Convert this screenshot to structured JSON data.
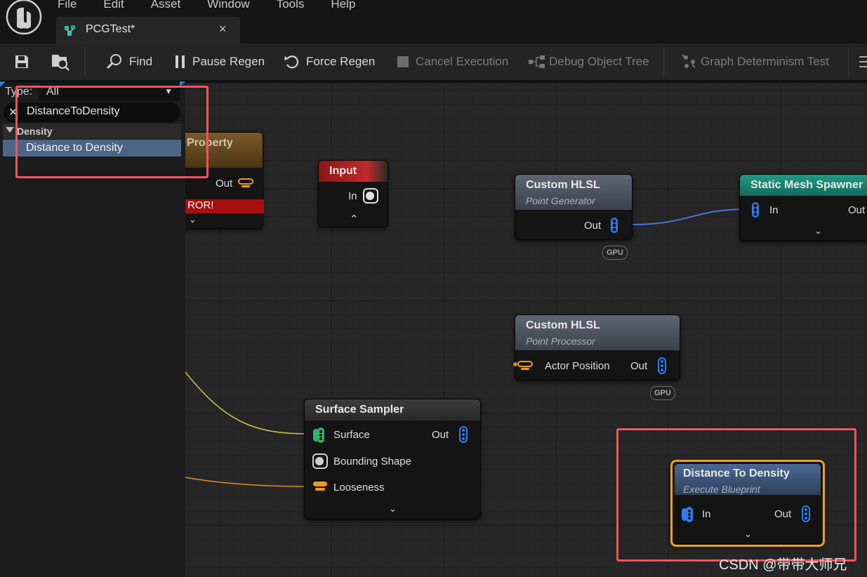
{
  "menu": [
    "File",
    "Edit",
    "Asset",
    "Window",
    "Tools",
    "Help"
  ],
  "tab": {
    "title": "PCGTest*",
    "close": "×"
  },
  "toolbar": {
    "find": "Find",
    "pause_regen": "Pause Regen",
    "force_regen": "Force Regen",
    "cancel_execution": "Cancel Execution",
    "debug_object_tree": "Debug Object Tree",
    "graph_determinism_test": "Graph Determinism Test"
  },
  "palette": {
    "type_label": "Type:",
    "type_value": "All",
    "search_value": "DistanceToDensity",
    "category": "Density",
    "result": "Distance to Density"
  },
  "nodes": {
    "property": {
      "title": "Property",
      "out": "Out",
      "error": "ROR!"
    },
    "input": {
      "title": "Input",
      "in": "In"
    },
    "hlsl_generator": {
      "title": "Custom HLSL",
      "subtitle": "Point Generator",
      "out": "Out",
      "badge": "GPU"
    },
    "static_mesh_spawner": {
      "title": "Static Mesh Spawner",
      "in": "In",
      "out": "Out"
    },
    "hlsl_processor": {
      "title": "Custom HLSL",
      "subtitle": "Point Processor",
      "in": "Actor Position",
      "out": "Out",
      "badge": "GPU"
    },
    "surface_sampler": {
      "title": "Surface Sampler",
      "surface": "Surface",
      "bounding_shape": "Bounding Shape",
      "looseness": "Looseness",
      "out": "Out"
    },
    "distance_to_density": {
      "title": "Distance To Density",
      "subtitle": "Execute Blueprint",
      "in": "In",
      "out": "Out"
    }
  },
  "colors": {
    "highlight": "#f4545f",
    "selected_outline": "#f0a020",
    "point_pin": "#2f7cf0",
    "surface_pin": "#2fb36a",
    "attribute_pin": "#f09a20"
  },
  "watermark": "CSDN @带带大师兄"
}
